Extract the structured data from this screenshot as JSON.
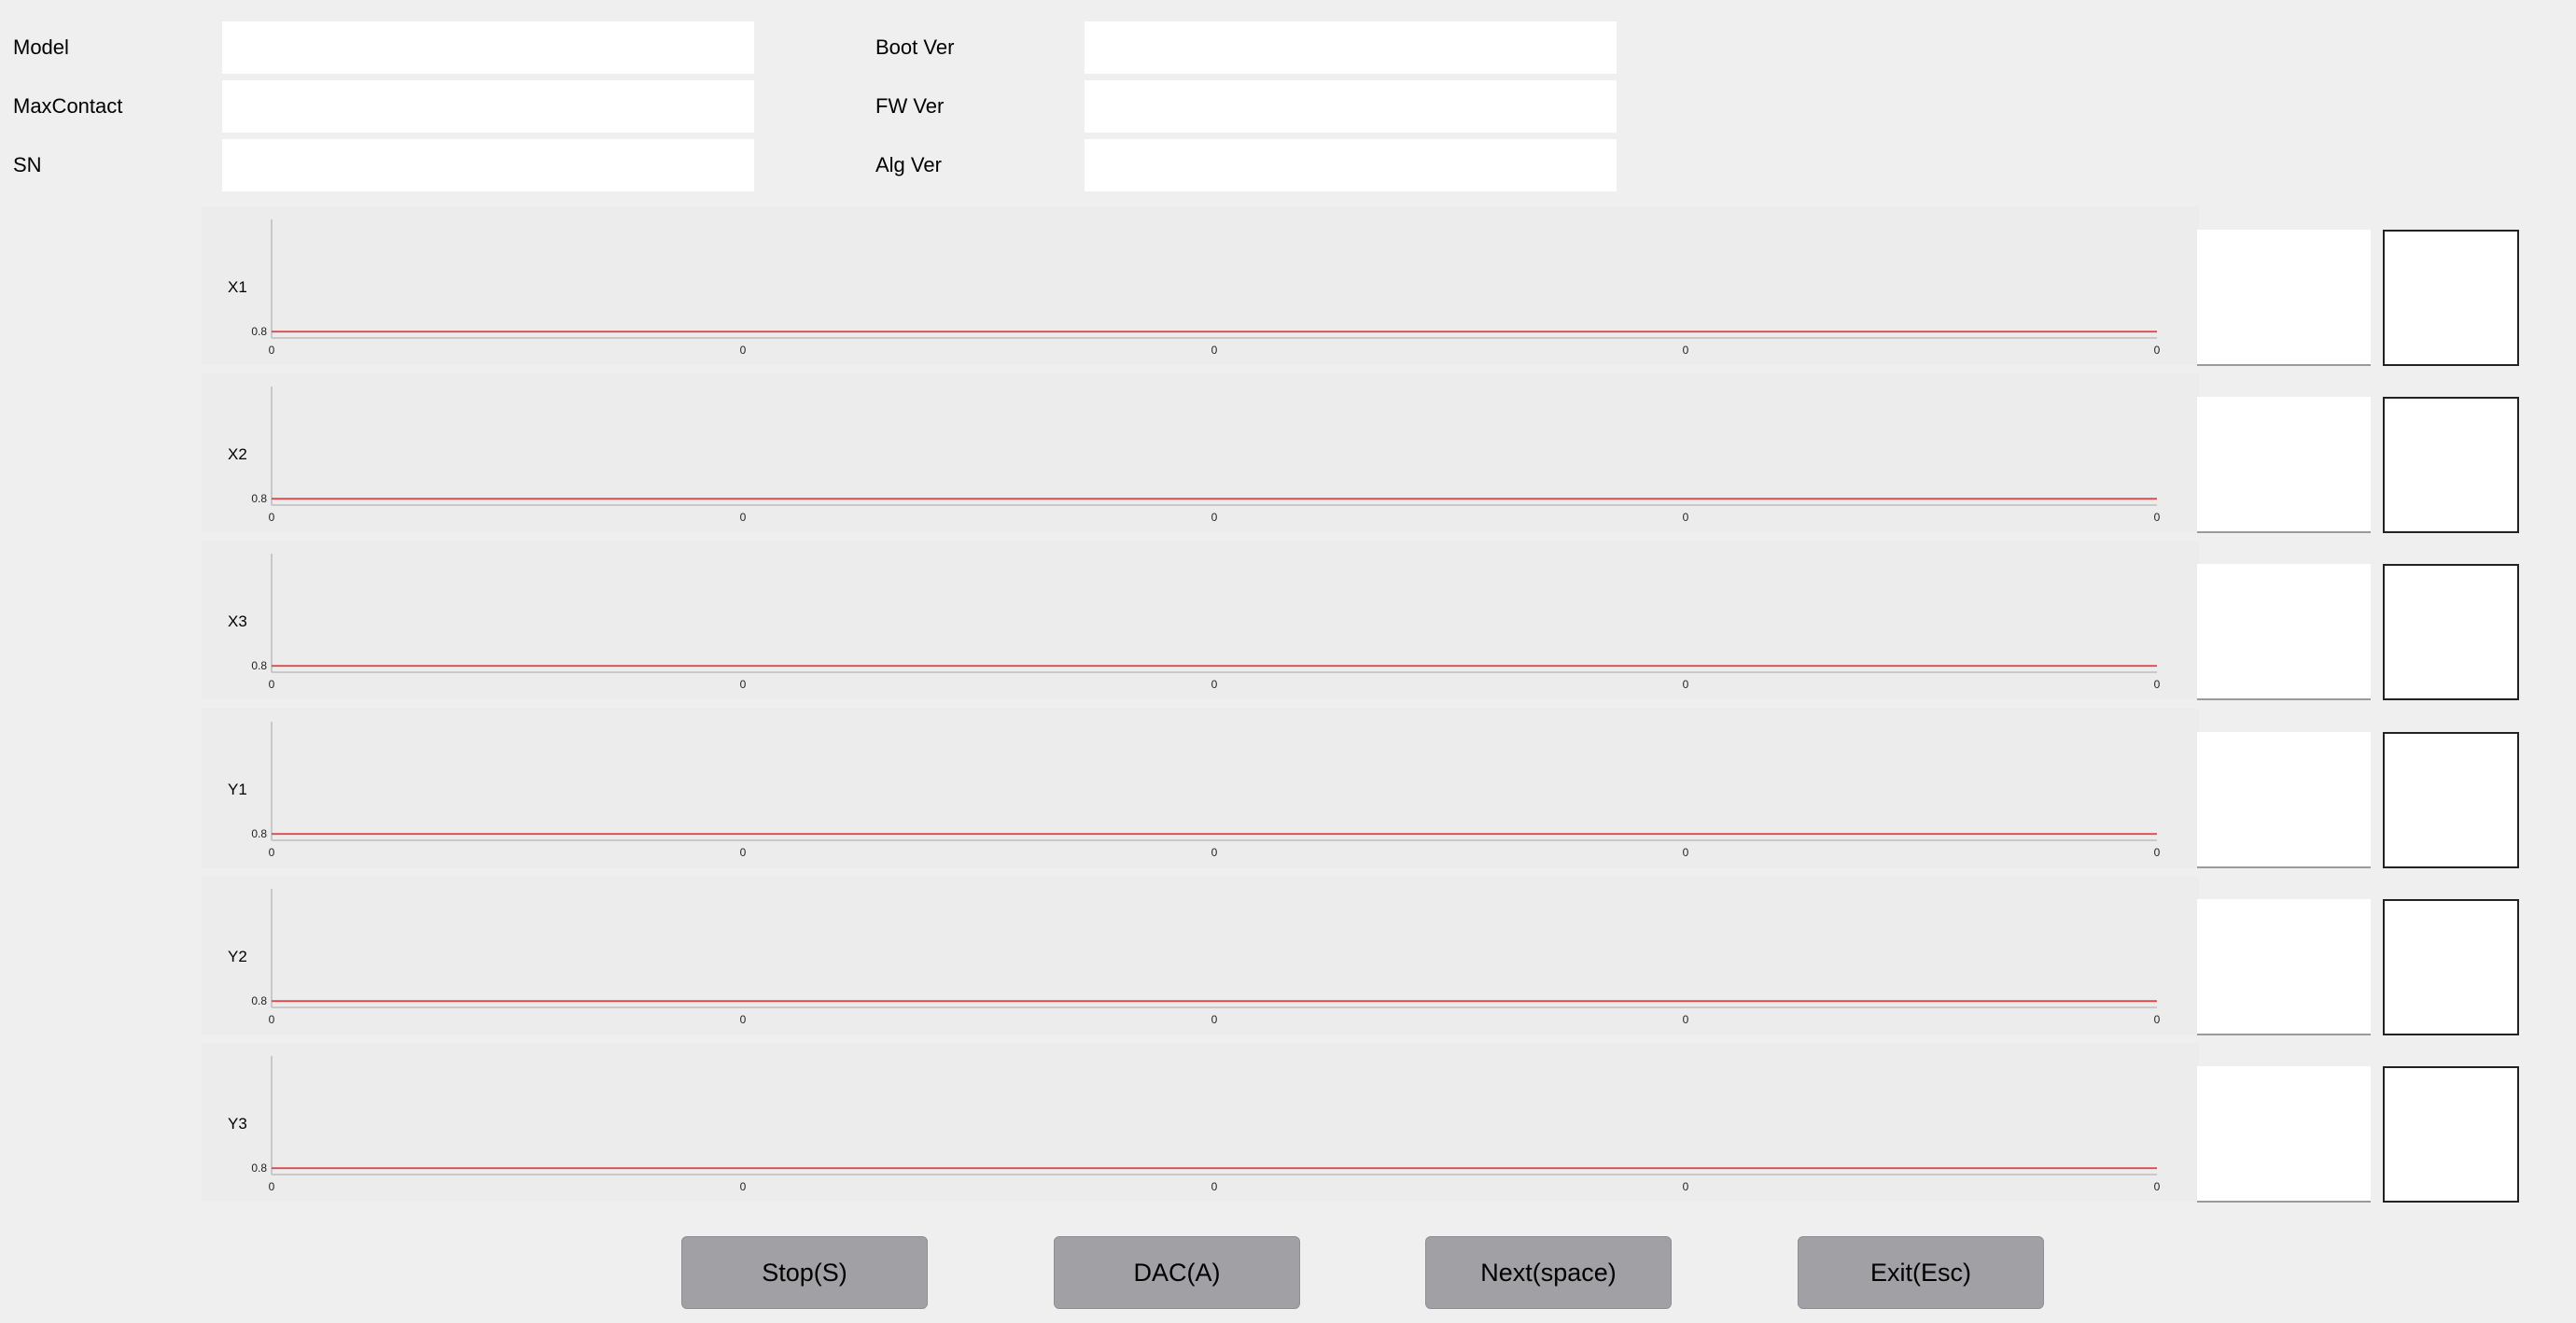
{
  "device_info": {
    "model": {
      "label": "Model",
      "value": ""
    },
    "max_contact": {
      "label": "MaxContact",
      "value": ""
    },
    "sn": {
      "label": "SN",
      "value": ""
    },
    "boot_ver": {
      "label": "Boot Ver",
      "value": ""
    },
    "fw_ver": {
      "label": "FW Ver",
      "value": ""
    },
    "alg_ver": {
      "label": "Alg Ver",
      "value": ""
    }
  },
  "chart_data": [
    {
      "type": "line",
      "channel": "X1",
      "y_value": 0.8,
      "y_tick": "0.8",
      "x_ticks": [
        "0",
        "0",
        "0",
        "0",
        "0"
      ],
      "series": [
        {
          "values": [
            0.8,
            0.8
          ],
          "color": "#e04848"
        }
      ]
    },
    {
      "type": "line",
      "channel": "X2",
      "y_value": 0.8,
      "y_tick": "0.8",
      "x_ticks": [
        "0",
        "0",
        "0",
        "0",
        "0"
      ],
      "series": [
        {
          "values": [
            0.8,
            0.8
          ],
          "color": "#e04848"
        }
      ]
    },
    {
      "type": "line",
      "channel": "X3",
      "y_value": 0.8,
      "y_tick": "0.8",
      "x_ticks": [
        "0",
        "0",
        "0",
        "0",
        "0"
      ],
      "series": [
        {
          "values": [
            0.8,
            0.8
          ],
          "color": "#e04848"
        }
      ]
    },
    {
      "type": "line",
      "channel": "Y1",
      "y_value": 0.8,
      "y_tick": "0.8",
      "x_ticks": [
        "0",
        "0",
        "0",
        "0",
        "0"
      ],
      "series": [
        {
          "values": [
            0.8,
            0.8
          ],
          "color": "#e04848"
        }
      ]
    },
    {
      "type": "line",
      "channel": "Y2",
      "y_value": 0.8,
      "y_tick": "0.8",
      "x_ticks": [
        "0",
        "0",
        "0",
        "0",
        "0"
      ],
      "series": [
        {
          "values": [
            0.8,
            0.8
          ],
          "color": "#e04848"
        }
      ]
    },
    {
      "type": "line",
      "channel": "Y3",
      "y_value": 0.8,
      "y_tick": "0.8",
      "x_ticks": [
        "0",
        "0",
        "0",
        "0",
        "0"
      ],
      "series": [
        {
          "values": [
            0.8,
            0.8
          ],
          "color": "#e04848"
        }
      ]
    }
  ],
  "buttons": {
    "stop": "Stop(S)",
    "dac": "DAC(A)",
    "next": "Next(space)",
    "exit": "Exit(Esc)"
  },
  "colors": {
    "background": "#efefef",
    "plot_background": "#ececec",
    "line": "#e04848",
    "button": "#a1a0a5"
  }
}
